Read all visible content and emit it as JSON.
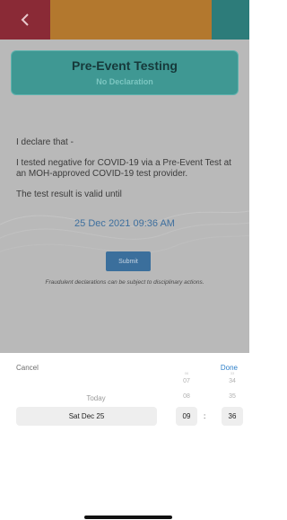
{
  "colors": {
    "back_button_bg": "#8a2a36",
    "topbar_mid": "#b3782e",
    "topbar_right": "#2d7c7a",
    "header_card_bg": "#3f9893",
    "date_text": "#3e6f9e",
    "submit_bg": "#3b6f9c",
    "done_text": "#2f80c9"
  },
  "header": {
    "back_icon": "chevron-left-icon",
    "title": "Pre-Event Testing",
    "subtitle": "No Declaration"
  },
  "declaration": {
    "intro": "I declare that -",
    "statement": "I tested negative for COVID-19 via a Pre-Event Test at an MOH-approved COVID-19 test provider.",
    "validity": "The test result is valid until",
    "valid_until": "25 Dec 2021 09:36 AM"
  },
  "submit": {
    "label": "Submit"
  },
  "warning": "Fraudulent declarations can be subject to disciplinary actions.",
  "picker": {
    "cancel": "Cancel",
    "done": "Done",
    "today_label": "Today",
    "selected_date": "Sat Dec 25",
    "hours_above": [
      "06",
      "07",
      "08"
    ],
    "selected_hour": "09",
    "colon": ":",
    "minutes_above": [
      "33",
      "34",
      "35"
    ],
    "selected_minute": "36"
  }
}
